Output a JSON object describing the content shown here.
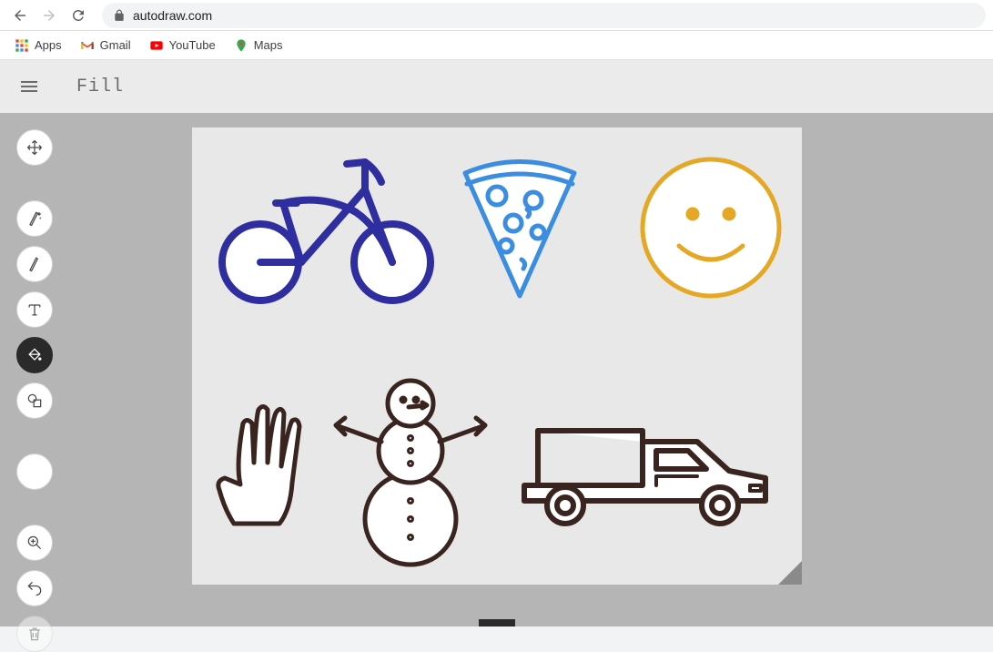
{
  "browser": {
    "url": "autodraw.com",
    "bookmarks": [
      {
        "label": "Apps",
        "icon": "apps"
      },
      {
        "label": "Gmail",
        "icon": "gmail"
      },
      {
        "label": "YouTube",
        "icon": "youtube"
      },
      {
        "label": "Maps",
        "icon": "maps"
      }
    ]
  },
  "app": {
    "current_tool_label": "Fill"
  },
  "tools": [
    {
      "name": "select",
      "active": false
    },
    {
      "name": "autodraw",
      "active": false
    },
    {
      "name": "draw",
      "active": false
    },
    {
      "name": "text",
      "active": false
    },
    {
      "name": "fill",
      "active": true
    },
    {
      "name": "shape",
      "active": false
    }
  ],
  "color": "#ffffff",
  "canvas": {
    "drawings": [
      {
        "id": "bicycle",
        "color": "#2e2ea0"
      },
      {
        "id": "pizza",
        "color": "#3a8de0"
      },
      {
        "id": "smiley",
        "color": "#e5a825"
      },
      {
        "id": "hand",
        "color": "#3a2420"
      },
      {
        "id": "snowman",
        "color": "#3a2420"
      },
      {
        "id": "truck",
        "color": "#3a2420"
      }
    ]
  }
}
